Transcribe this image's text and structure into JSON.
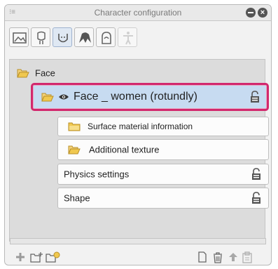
{
  "window": {
    "title": "Character configuration"
  },
  "tabs": [
    {
      "name": "image-tab",
      "icon": "picture-icon"
    },
    {
      "name": "head-tab",
      "icon": "head-icon"
    },
    {
      "name": "face-tab",
      "icon": "face-icon",
      "active": true
    },
    {
      "name": "hair-tab",
      "icon": "hair-icon"
    },
    {
      "name": "body-tab",
      "icon": "shirt-icon"
    },
    {
      "name": "pose-tab",
      "icon": "figure-icon"
    }
  ],
  "tree": {
    "root": {
      "label": "Face"
    },
    "selected": {
      "label": "Face _ women (rotundly)"
    },
    "children": [
      {
        "label": "Surface material information"
      },
      {
        "label": "Additional texture"
      },
      {
        "label": "Physics settings",
        "locked": true
      },
      {
        "label": "Shape",
        "locked": true
      }
    ]
  },
  "colors": {
    "selection_border": "#d2286d",
    "selection_bg": "#c7dbf1",
    "folder": "#f0c84f"
  }
}
